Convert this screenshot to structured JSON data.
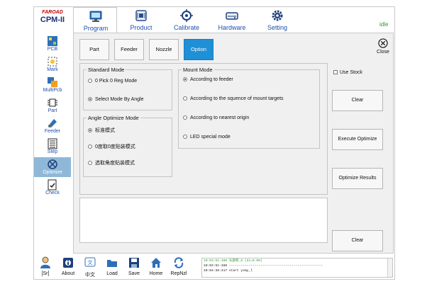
{
  "brand": {
    "company": "FAROAD",
    "model": "CPM-II"
  },
  "status": "idle",
  "main_tabs": [
    {
      "label": "Program",
      "icon": "monitor-icon"
    },
    {
      "label": "Product",
      "icon": "circuit-board-icon"
    },
    {
      "label": "Calibrate",
      "icon": "crosshair-icon"
    },
    {
      "label": "Hardware",
      "icon": "hard-drive-icon"
    },
    {
      "label": "Setting",
      "icon": "gear-icon"
    }
  ],
  "left_nav": [
    {
      "label": "PCB",
      "icon": "pcb-icon"
    },
    {
      "label": "Mark",
      "icon": "mark-target-icon"
    },
    {
      "label": "MultiPcb",
      "icon": "multi-pcb-icon"
    },
    {
      "label": "Part",
      "icon": "chip-icon"
    },
    {
      "label": "Feeder",
      "icon": "feeder-icon"
    },
    {
      "label": "Step",
      "icon": "step-list-icon"
    },
    {
      "label": "Optimize",
      "icon": "optimize-icon"
    },
    {
      "label": "Check",
      "icon": "check-document-icon"
    }
  ],
  "sub_tabs": [
    "Part",
    "Feeder",
    "Nozzle",
    "Option"
  ],
  "close_label": "Close",
  "standard_mode": {
    "title": "Standard Mode",
    "options": [
      "0 Pick 0 Reg Mode",
      "Select Mode By Angle"
    ],
    "selected": 1
  },
  "angle_optimize_mode": {
    "title": "Angle Optimize Mode",
    "options": [
      "标准模式",
      "0度取0度贴装模式",
      "选取角度贴装模式"
    ],
    "selected": 0
  },
  "mount_mode": {
    "title": "Mount Mode",
    "options": [
      "According to feeder",
      "According to the squence of mount targets",
      "According to nearest origin",
      "LED special mode"
    ],
    "selected": 0
  },
  "use_stock_label": "Use Stock",
  "side_buttons": {
    "clear_top": "Clear",
    "execute": "Execute Optimize",
    "results": "Optimize Results",
    "clear_bottom": "Clear"
  },
  "bottom_buttons": [
    {
      "label": "[Sr]",
      "icon": "user-icon"
    },
    {
      "label": "About",
      "icon": "info-icon"
    },
    {
      "label": "中文",
      "icon": "language-icon"
    },
    {
      "label": "Load",
      "icon": "folder-icon"
    },
    {
      "label": "Save",
      "icon": "save-disk-icon"
    },
    {
      "label": "Home",
      "icon": "home-icon"
    },
    {
      "label": "RepNzl",
      "icon": "replace-nozzle-icon"
    }
  ],
  "log_lines": [
    "10:03:51:488 头部移_0 (dx=0.00)",
    "10:03:51:488 ------------------------------------------------",
    "10:04:38:417 start ysmy_l"
  ]
}
